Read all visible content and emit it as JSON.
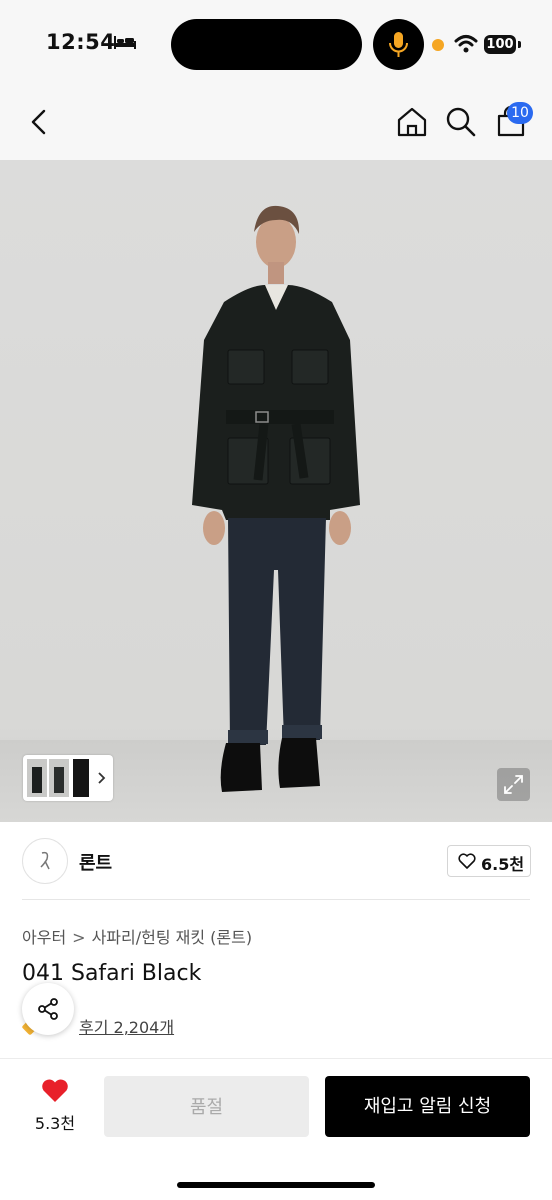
{
  "status_bar": {
    "time": "12:54",
    "battery": "100",
    "icons": [
      "bed-icon",
      "mic-icon",
      "wifi-icon",
      "battery-icon"
    ]
  },
  "nav": {
    "icons": [
      "back-icon",
      "home-icon",
      "search-icon",
      "cart-icon"
    ],
    "cart_count": "10"
  },
  "product_image": {
    "gallery_icons": [
      "thumbnail-strip",
      "chevron-right-icon",
      "expand-icon"
    ]
  },
  "brand": {
    "name": "론트",
    "likes": "6.5천"
  },
  "breadcrumb": {
    "items": [
      "아우터",
      "사파리/헌팅 재킷 (론트)"
    ],
    "separator": ">"
  },
  "product": {
    "title": "041 Safari Black",
    "reviews": "후기 2,204개"
  },
  "bottom_bar": {
    "wish_count": "5.3천",
    "soldout_label": "품절",
    "restock_label": "재입고 알림 신청"
  },
  "colors": {
    "badge": "#2a6af0",
    "heart": "#e8202a",
    "primary_button": "#000000"
  }
}
